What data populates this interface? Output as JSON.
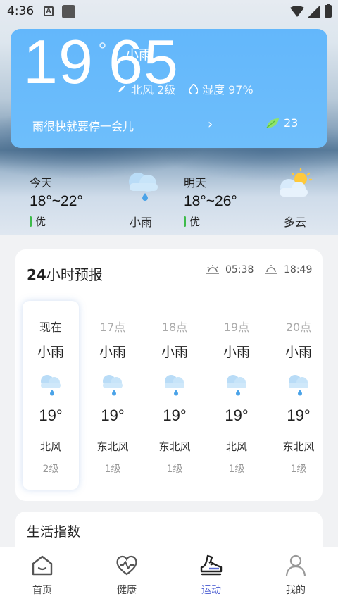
{
  "status_bar": {
    "time": "4:36"
  },
  "now": {
    "temperature": "19",
    "degree_symbol": "°",
    "overlay_text": "65",
    "condition": "小雨",
    "wind": "北风 2级",
    "humidity_label": "湿度 97%",
    "alert": "雨很快就要停一会儿",
    "aqi": "23"
  },
  "today": {
    "label": "今天",
    "range": "18°~22°",
    "quality": "优",
    "condition": "小雨"
  },
  "tomorrow": {
    "label": "明天",
    "range": "18°~26°",
    "quality": "优",
    "condition": "多云"
  },
  "forecast24": {
    "title_bold": "24",
    "title_rest": "小时预报",
    "sunrise": "05:38",
    "sunset": "18:49",
    "hours": [
      {
        "time": "现在",
        "cond": "小雨",
        "temp": "19°",
        "dir": "北风",
        "level": "2级"
      },
      {
        "time": "17点",
        "cond": "小雨",
        "temp": "19°",
        "dir": "东北风",
        "level": "1级"
      },
      {
        "time": "18点",
        "cond": "小雨",
        "temp": "19°",
        "dir": "东北风",
        "level": "1级"
      },
      {
        "time": "19点",
        "cond": "小雨",
        "temp": "19°",
        "dir": "北风",
        "level": "1级"
      },
      {
        "time": "20点",
        "cond": "小雨",
        "temp": "19°",
        "dir": "东北风",
        "level": "1级"
      }
    ]
  },
  "life_index": {
    "title": "生活指数"
  },
  "nav": {
    "items": [
      {
        "label": "首页",
        "icon": "home-icon"
      },
      {
        "label": "健康",
        "icon": "heart-icon"
      },
      {
        "label": "运动",
        "icon": "shoe-icon"
      },
      {
        "label": "我的",
        "icon": "profile-icon"
      }
    ],
    "active_color": "#5a6bd6"
  }
}
